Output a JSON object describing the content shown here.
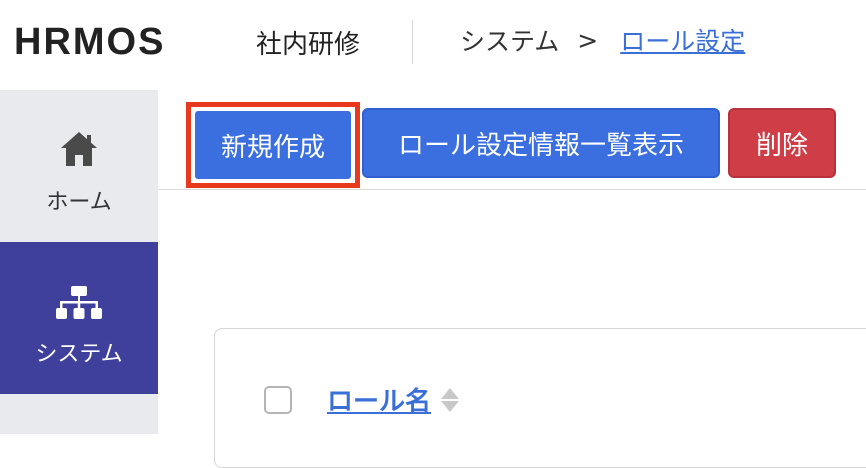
{
  "header": {
    "logo": "HRMOS",
    "product": "社内研修",
    "breadcrumb": {
      "section": "システム",
      "separator": ">",
      "current": "ロール設定"
    }
  },
  "sidebar": {
    "items": [
      {
        "label": "ホーム",
        "icon": "home-icon",
        "active": false
      },
      {
        "label": "システム",
        "icon": "sitemap-icon",
        "active": true
      }
    ]
  },
  "toolbar": {
    "new_label": "新規作成",
    "list_label": "ロール設定情報一覧表示",
    "delete_label": "削除"
  },
  "table": {
    "columns": [
      {
        "label": "ロール名",
        "sortable": true
      }
    ]
  },
  "colors": {
    "primary": "#3b6fe0",
    "danger": "#cf3d47",
    "highlight": "#e8391e",
    "sidebar_active": "#3f3f9c",
    "sidebar_bg": "#e8eaed",
    "link": "#3a6fd8"
  }
}
